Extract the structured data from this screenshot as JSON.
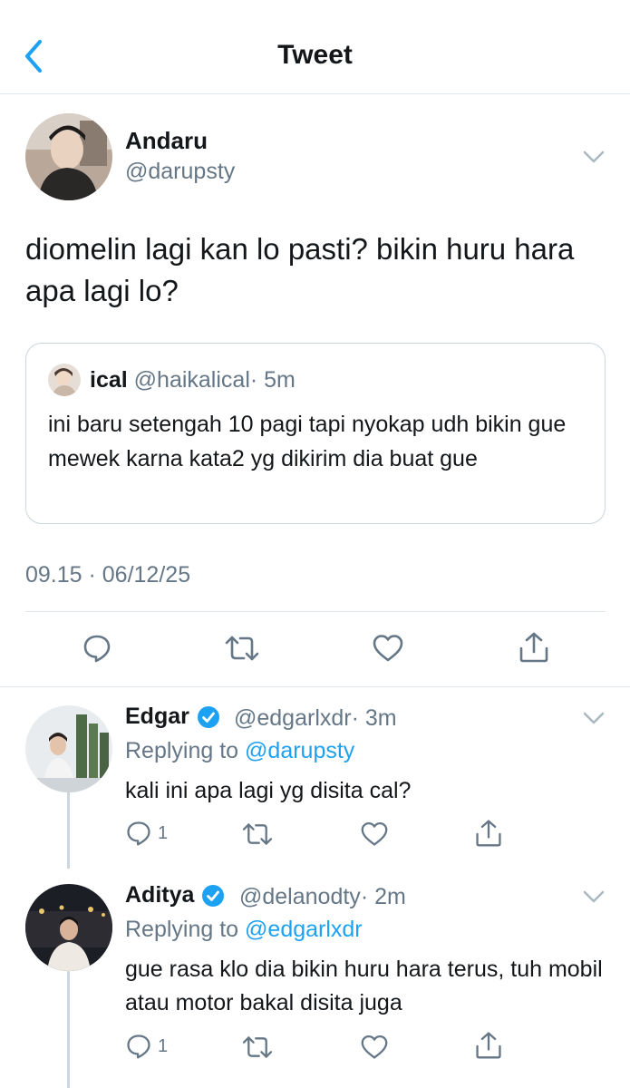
{
  "header": {
    "title": "Tweet"
  },
  "main_tweet": {
    "name": "Andaru",
    "handle": "@darupsty",
    "text": "diomelin lagi kan lo pasti? bikin huru hara apa lagi lo?",
    "timestamp": "09.15 · 06/12/25",
    "quote": {
      "name": "ical",
      "handle": "@haikalical",
      "time": "· 5m",
      "text": "ini baru setengah 10 pagi tapi nyokap udh bikin gue mewek karna kata2 yg dikirim dia buat gue"
    }
  },
  "replies": [
    {
      "name": "Edgar",
      "handle": "@edgarlxdr",
      "time": "· 3m",
      "replying_prefix": "Replying to ",
      "replying_to": "@darupsty",
      "text": "kali ini apa lagi yg disita cal?",
      "reply_count": "1"
    },
    {
      "name": "Aditya",
      "handle": "@delanodty",
      "time": "· 2m",
      "replying_prefix": "Replying to ",
      "replying_to": "@edgarlxdr",
      "text": "gue rasa klo dia bikin huru hara terus, tuh mobil atau motor bakal disita juga",
      "reply_count": "1"
    }
  ],
  "icons": {
    "back": "chevron-left-icon",
    "more": "chevron-down-icon",
    "reply": "comment-icon",
    "retweet": "retweet-icon",
    "like": "heart-icon",
    "share": "share-icon",
    "verified": "verified-badge-icon"
  },
  "colors": {
    "accent": "#1da1f2",
    "text": "#14171a",
    "secondary": "#657786",
    "border": "#e1e8ed"
  }
}
